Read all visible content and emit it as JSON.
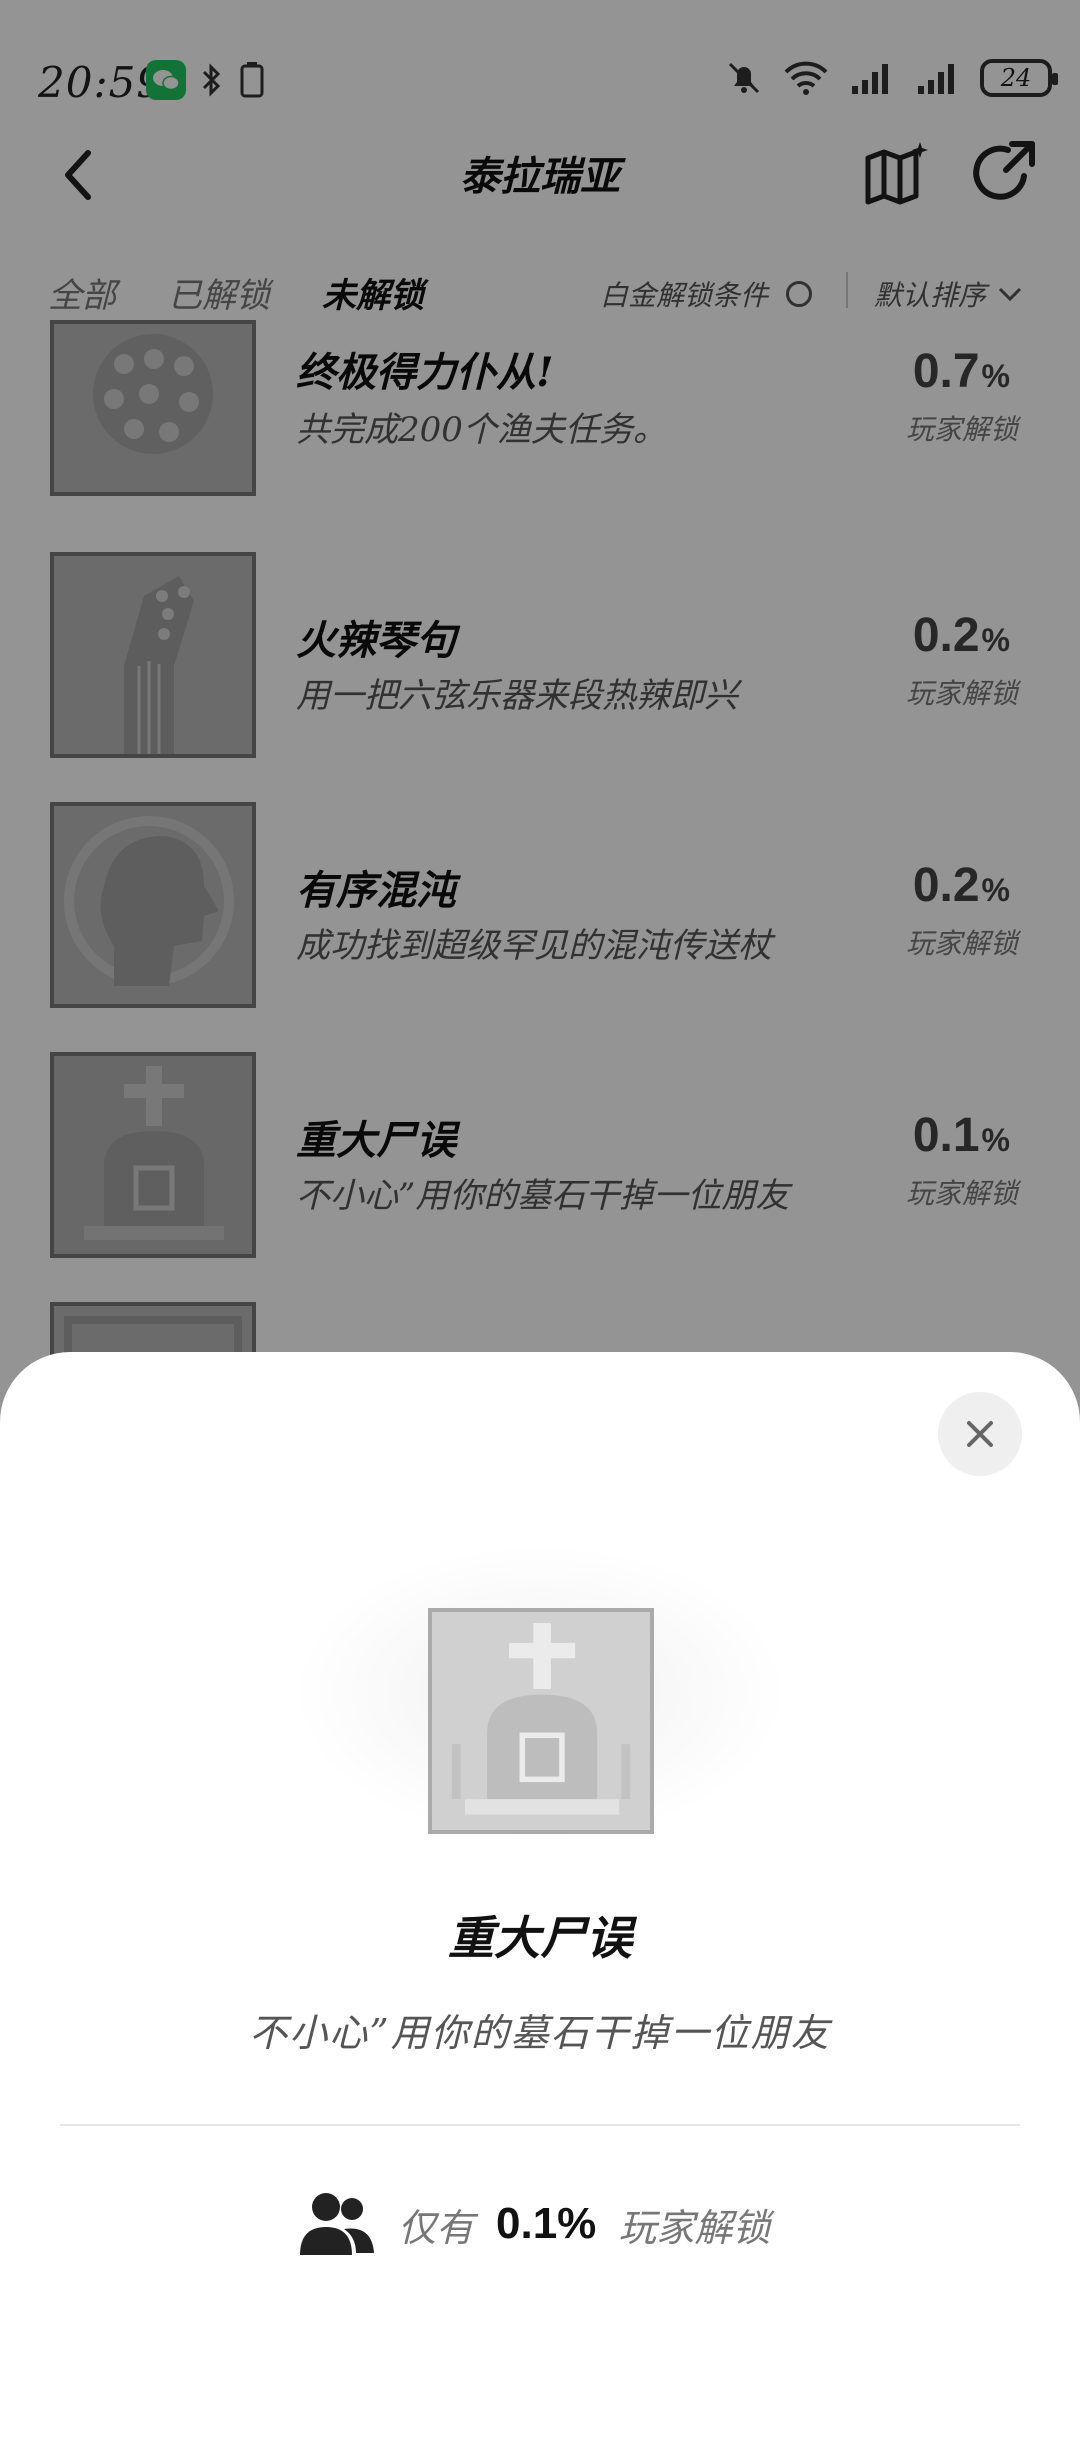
{
  "status_bar": {
    "time": "20:59",
    "battery": "24"
  },
  "header": {
    "title": "泰拉瑞亚"
  },
  "tabs": [
    {
      "label": "全部"
    },
    {
      "label": "已解锁"
    },
    {
      "label": "未解锁"
    }
  ],
  "platinum_filter": {
    "label": "白金解锁条件"
  },
  "sort": {
    "label": "默认排序"
  },
  "items": [
    {
      "title": "终极得力仆从!",
      "desc": "共完成200个渔夫任务。",
      "percent": "0.7",
      "percent_sign": "%",
      "players": "玩家解锁"
    },
    {
      "title": "火辣琴句",
      "desc": "用一把六弦乐器来段热辣即兴",
      "percent": "0.2",
      "percent_sign": "%",
      "players": "玩家解锁"
    },
    {
      "title": "有序混沌",
      "desc": "成功找到超级罕见的混沌传送杖",
      "percent": "0.2",
      "percent_sign": "%",
      "players": "玩家解锁"
    },
    {
      "title": "重大尸误",
      "desc": "不小心”用你的墓石干掉一位朋友",
      "percent": "0.1",
      "percent_sign": "%",
      "players": "玩家解锁"
    }
  ],
  "detail_sheet": {
    "title": "重大尸误",
    "desc": "不小心”用你的墓石干掉一位朋友",
    "unlock_prefix": "仅有",
    "unlock_percent": "0.1%",
    "unlock_suffix": "玩家解锁"
  },
  "colors": {
    "wechat": "#22c55e",
    "overlay": "rgba(0,0,0,0.42)"
  }
}
